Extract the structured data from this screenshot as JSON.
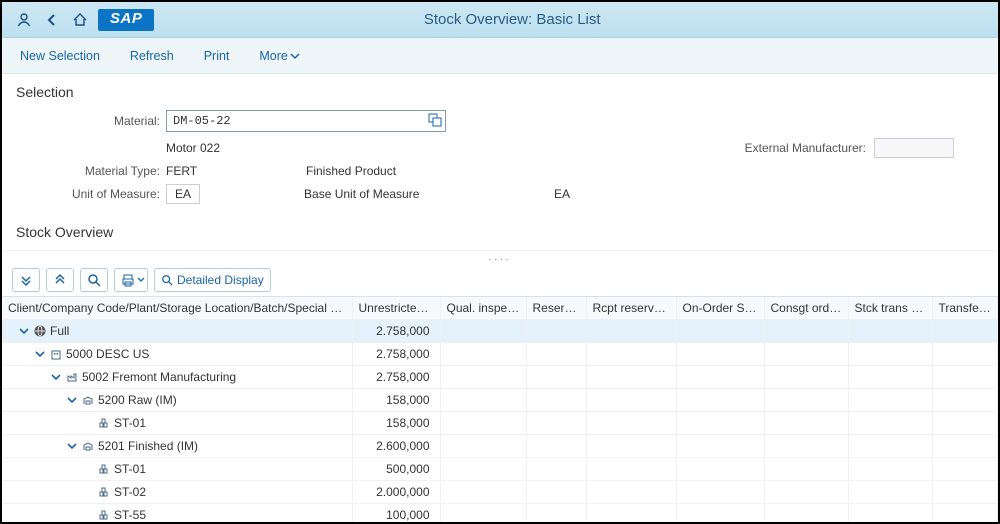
{
  "shell": {
    "title": "Stock Overview: Basic List"
  },
  "toolbar": {
    "new_selection": "New Selection",
    "refresh": "Refresh",
    "print": "Print",
    "more": "More"
  },
  "selection": {
    "title": "Selection",
    "material_label": "Material:",
    "material_value": "DM-05-22",
    "material_desc": "Motor 022",
    "material_type_label": "Material Type:",
    "material_type_value": "FERT",
    "material_type_desc": "Finished Product",
    "uom_label": "Unit of Measure:",
    "uom_value": "EA",
    "base_uom_label": "Base Unit of Measure",
    "base_uom_value": "EA",
    "ext_manuf_label": "External Manufacturer:",
    "ext_manuf_value": ""
  },
  "overview": {
    "title": "Stock Overview",
    "detailed_display": "Detailed Display",
    "columns": {
      "hierarchy": "Client/Company Code/Plant/Storage Location/Batch/Special Stock",
      "unrestricted": "Unrestricted use",
      "qual": "Qual. inspection",
      "reserved": "Reserved",
      "rcpt": "Rcpt reservation",
      "on_order": "On-Order Stock",
      "consgt": "Consgt ordered",
      "stck_plnt": "Stck trans (plnt)",
      "transfer_sloc": "Transfer (SLoc)"
    },
    "rows": [
      {
        "indent": 0,
        "exp": true,
        "icon": "world",
        "label": "Full",
        "unrestricted": "2.758,000"
      },
      {
        "indent": 1,
        "exp": true,
        "icon": "company",
        "label": "5000 DESC US",
        "unrestricted": "2.758,000"
      },
      {
        "indent": 2,
        "exp": true,
        "icon": "plant",
        "label": "5002 Fremont Manufacturing",
        "unrestricted": "2.758,000"
      },
      {
        "indent": 3,
        "exp": true,
        "icon": "storage",
        "label": "5200 Raw (IM)",
        "unrestricted": "158,000"
      },
      {
        "indent": 4,
        "exp": false,
        "icon": "batch",
        "label": "ST-01",
        "unrestricted": "158,000"
      },
      {
        "indent": 3,
        "exp": true,
        "icon": "storage",
        "label": "5201 Finished (IM)",
        "unrestricted": "2.600,000"
      },
      {
        "indent": 4,
        "exp": false,
        "icon": "batch",
        "label": "ST-01",
        "unrestricted": "500,000"
      },
      {
        "indent": 4,
        "exp": false,
        "icon": "batch",
        "label": "ST-02",
        "unrestricted": "2.000,000"
      },
      {
        "indent": 4,
        "exp": false,
        "icon": "batch",
        "label": "ST-55",
        "unrestricted": "100,000"
      }
    ]
  }
}
